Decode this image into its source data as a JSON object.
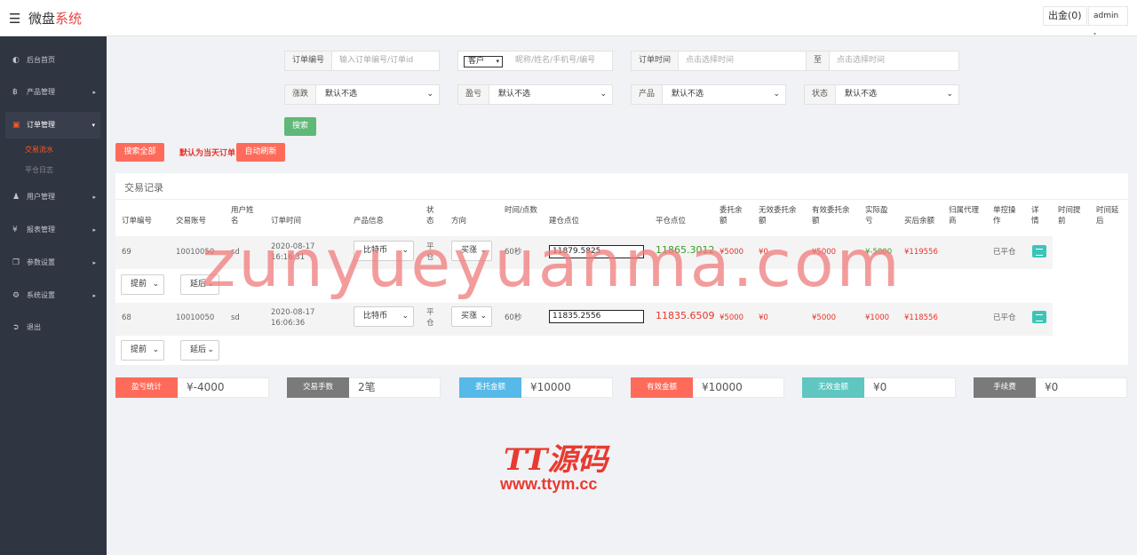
{
  "header": {
    "logo_main": "微盘",
    "logo_accent": "系统",
    "withdraw_btn": "出金(0)",
    "user_btn": "admin"
  },
  "sidebar": {
    "items": [
      {
        "label": "后台首页",
        "icon": "dashboard-icon"
      },
      {
        "label": "产品管理",
        "icon": "bitcoin-icon"
      },
      {
        "label": "订单管理",
        "icon": "order-icon"
      },
      {
        "label": "用户管理",
        "icon": "user-icon"
      },
      {
        "label": "报表管理",
        "icon": "yen-icon"
      },
      {
        "label": "参数设置",
        "icon": "copy-icon"
      },
      {
        "label": "系统设置",
        "icon": "cogs-icon"
      },
      {
        "label": "退出",
        "icon": "signout-icon"
      }
    ],
    "sub_items": [
      "交易流水",
      "平仓日志"
    ]
  },
  "filters": {
    "order_no_label": "订单编号",
    "order_no_placeholder": "输入订单编号/订单id",
    "customer_select": "客户",
    "customer_placeholder": "昵称/姓名/手机号/编号",
    "order_time_label": "订单时间",
    "time_placeholder": "点击选择时间",
    "to_label": "至",
    "updown_label": "涨跌",
    "profit_label": "盈亏",
    "product_label": "产品",
    "status_label": "状态",
    "default_option": "默认不选",
    "search_btn": "搜索",
    "search_all_btn": "搜索全部",
    "default_today": "默认为当天订单",
    "auto_refresh_btn": "自动刷新"
  },
  "table": {
    "title": "交易记录",
    "headers": [
      "订单编号",
      "交易账号",
      "用户姓名",
      "订单时间",
      "产品信息",
      "状态",
      "方向",
      "时间/点数",
      "建仓点位",
      "平仓点位",
      "委托余额",
      "无效委托余额",
      "有效委托余额",
      "实际盈亏",
      "买后余额",
      "归属代理商",
      "单控操作",
      "详情",
      "时间提前",
      "时间延后"
    ],
    "rows": [
      {
        "id": "69",
        "account": "10010050",
        "name": "sd",
        "date": "2020-08-17",
        "time": "16:16:31",
        "product": "比特币",
        "status": "平仓",
        "direction": "买涨",
        "duration": "60秒",
        "open": "11879.5825",
        "close": "11865.3012",
        "entrust": "¥5000",
        "invalid": "¥0",
        "valid": "¥5000",
        "pnl": "¥-5000",
        "balance": "¥119556",
        "op": "已平仓",
        "advance": "提前",
        "delay": "延后"
      },
      {
        "id": "68",
        "account": "10010050",
        "name": "sd",
        "date": "2020-08-17",
        "time": "16:06:36",
        "product": "比特币",
        "status": "平仓",
        "direction": "买涨",
        "duration": "60秒",
        "open": "11835.2556",
        "close": "11835.6509",
        "entrust": "¥5000",
        "invalid": "¥0",
        "valid": "¥5000",
        "pnl": "¥1000",
        "balance": "¥118556",
        "op": "已平仓",
        "advance": "提前",
        "delay": "延后"
      }
    ]
  },
  "stats": [
    {
      "label": "盈亏统计",
      "value": "¥-4000",
      "color": "#ff6b5a"
    },
    {
      "label": "交易手数",
      "value": "2笔",
      "color": "#7a7a7a"
    },
    {
      "label": "委托金额",
      "value": "¥10000",
      "color": "#56b9e8"
    },
    {
      "label": "有效金额",
      "value": "¥10000",
      "color": "#ff6b5a"
    },
    {
      "label": "无效金额",
      "value": "¥0",
      "color": "#5fc6c0"
    },
    {
      "label": "手续费",
      "value": "¥0",
      "color": "#7a7a7a"
    }
  ],
  "watermark": {
    "text": "zunyueyuanma.com",
    "brand": "TT源码",
    "site": "www.ttym.cc"
  }
}
